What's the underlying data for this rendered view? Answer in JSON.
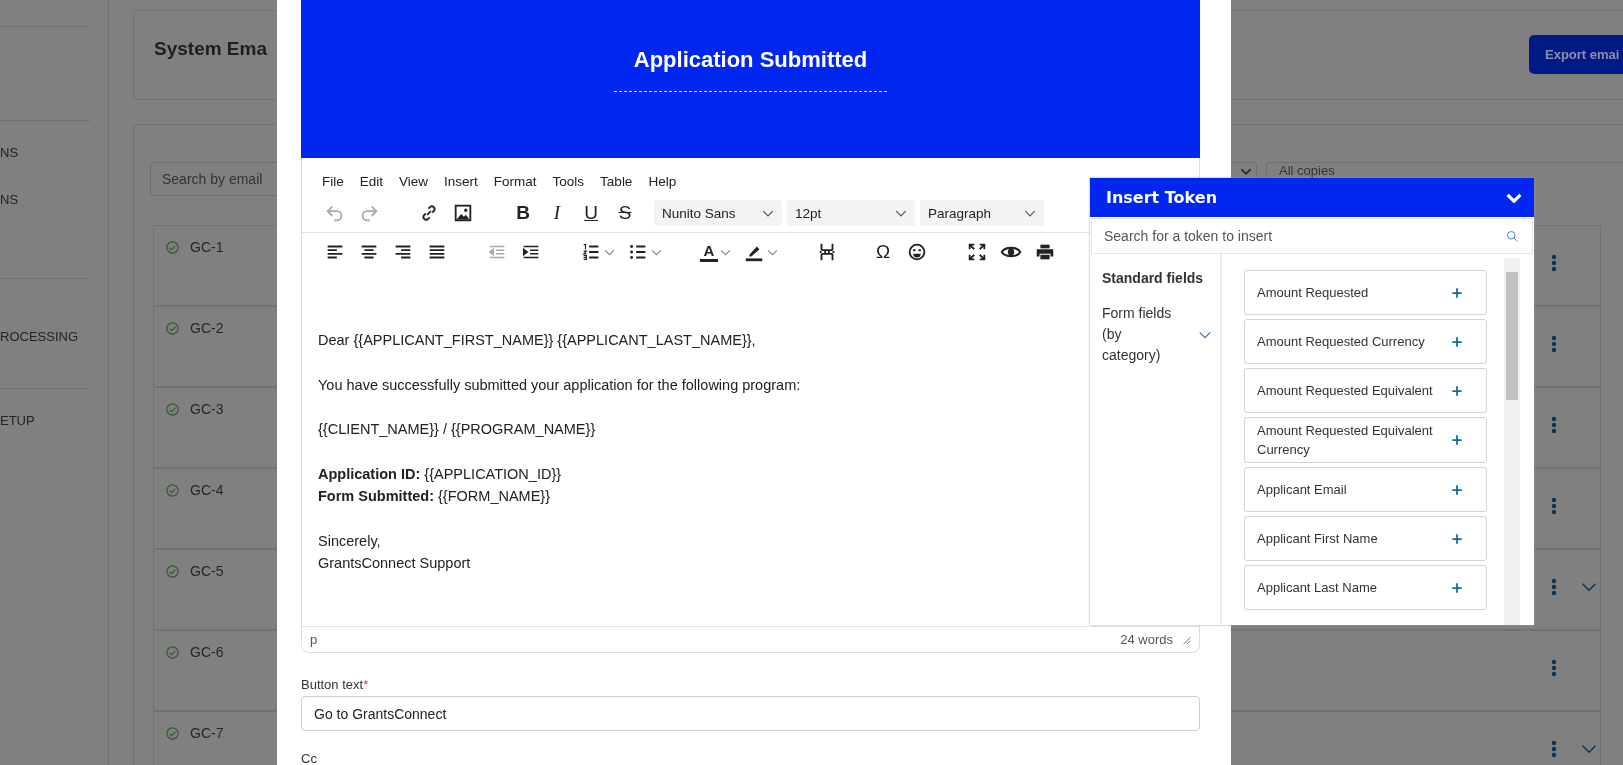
{
  "background": {
    "sidebar_items": [
      "NS",
      "NS",
      "ROCESSING",
      "ETUP"
    ],
    "page_title": "System Ema",
    "export_button": "Export emai",
    "search": {
      "placeholder": "Search by email"
    },
    "copies_filter": {
      "value": "All copies"
    },
    "rows": [
      {
        "id": "GC-1",
        "expandable": false
      },
      {
        "id": "GC-2",
        "expandable": false
      },
      {
        "id": "GC-3",
        "expandable": false
      },
      {
        "id": "GC-4",
        "expandable": false
      },
      {
        "id": "GC-5",
        "expandable": true
      },
      {
        "id": "GC-6",
        "expandable": false
      },
      {
        "id": "GC-7",
        "expandable": true
      }
    ]
  },
  "modal": {
    "banner_title": "Application Submitted",
    "editor": {
      "menu": [
        "File",
        "Edit",
        "View",
        "Insert",
        "Format",
        "Tools",
        "Table",
        "Help"
      ],
      "toolbar_1": [
        {
          "kind": "undo",
          "disabled": true
        },
        {
          "kind": "redo",
          "disabled": true
        },
        {
          "kind": "link",
          "disabled": false
        },
        {
          "kind": "image",
          "disabled": false
        },
        {
          "kind": "glyph",
          "glyph": "B",
          "disabled": false
        },
        {
          "kind": "glyph",
          "glyph": "I",
          "disabled": false
        },
        {
          "kind": "glyph",
          "glyph": "U",
          "disabled": false
        },
        {
          "kind": "glyph",
          "glyph": "S",
          "disabled": false
        }
      ],
      "selects": [
        "Nunito Sans",
        "12pt",
        "Paragraph"
      ],
      "toolbar_2": [
        {
          "kind": "align-left",
          "disabled": false
        },
        {
          "kind": "align-center",
          "disabled": false
        },
        {
          "kind": "align-right",
          "disabled": false
        },
        {
          "kind": "justify",
          "disabled": false
        },
        {
          "kind": "outdent",
          "disabled": true
        },
        {
          "kind": "indent",
          "disabled": false
        },
        {
          "kind": "numbered-list",
          "disabled": false
        },
        {
          "kind": "bullet-list",
          "disabled": false
        },
        {
          "kind": "text-color",
          "glyph": "A",
          "disabled": false
        },
        {
          "kind": "highlight",
          "disabled": false
        },
        {
          "kind": "page-break",
          "disabled": false
        },
        {
          "kind": "glyph",
          "glyph": "Ω",
          "disabled": false
        },
        {
          "kind": "emoji",
          "disabled": false
        },
        {
          "kind": "fullscreen",
          "disabled": false
        },
        {
          "kind": "preview",
          "disabled": false
        },
        {
          "kind": "print",
          "disabled": false
        }
      ],
      "paragraphs": [
        {
          "lines": [
            "Dear {{APPLICANT_FIRST_NAME}} {{APPLICANT_LAST_NAME}},"
          ]
        },
        {
          "lines": [
            "You have successfully submitted your application for the following program:"
          ]
        },
        {
          "lines": [
            "{{CLIENT_NAME}} / {{PROGRAM_NAME}}"
          ]
        },
        {
          "lines": [
            "**Application ID:** {{APPLICATION_ID}}",
            "**Form Submitted:** {{FORM_NAME}}"
          ]
        },
        {
          "lines": [
            "Sincerely,",
            "GrantsConnect Support"
          ]
        }
      ],
      "path": "p",
      "word_count": "24 words"
    },
    "button_text": {
      "label": "Button text",
      "required_mark": "*",
      "value": "Go to GrantsConnect"
    },
    "cc": {
      "label": "Cc"
    }
  },
  "insert_token": {
    "title": "Insert Token",
    "search": {
      "placeholder": "Search for a token to insert"
    },
    "categories": [
      {
        "label": "Standard fields",
        "selected": true,
        "expandable": false
      },
      {
        "label": "Form fields (by category)",
        "selected": false,
        "expandable": true
      }
    ],
    "tokens": [
      "Amount Requested",
      "Amount Requested Currency",
      "Amount Requested Equivalent",
      "Amount Requested Equivalent Currency",
      "Applicant Email",
      "Applicant First Name",
      "Applicant Last Name"
    ]
  }
}
